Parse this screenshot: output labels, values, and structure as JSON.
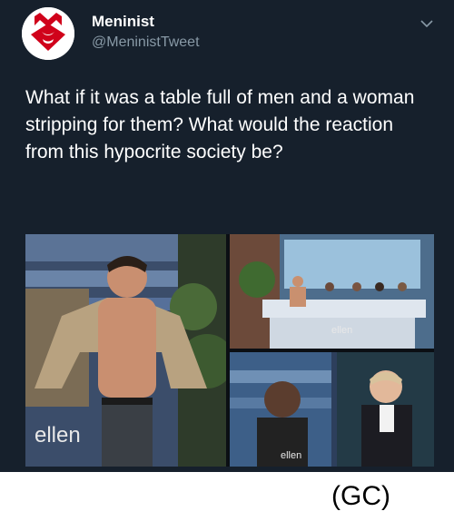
{
  "tweet": {
    "display_name": "Meninist",
    "handle": "@MeninistTweet",
    "text": "What if it was a table full of men and a woman stripping for them? What would the reaction from this hypocrite society be?",
    "menu_icon": "chevron-down-icon",
    "avatar_icon": "red-shield-logo",
    "media": {
      "panel1_watermark": "ellen",
      "panel2_watermark": "ellen",
      "panel3_watermark": "ellen"
    }
  },
  "caption": "(GC)",
  "colors": {
    "tweet_background": "#16202c",
    "accent_red": "#d0021b",
    "handle_gray": "#8899a6"
  }
}
